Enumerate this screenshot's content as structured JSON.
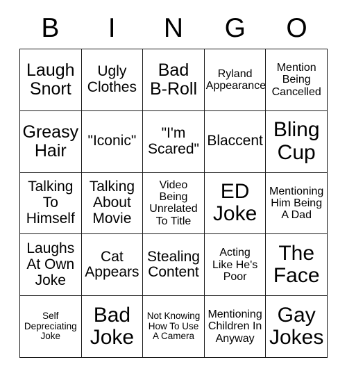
{
  "card": {
    "header_letters": [
      "B",
      "I",
      "N",
      "G",
      "O"
    ],
    "border_color": "#1a1a1a",
    "background_color": "#ffffff",
    "text_color": "#000000",
    "rows": 5,
    "columns": 5
  },
  "cells": [
    {
      "text": "Laugh\nSnort",
      "size": "s-lg"
    },
    {
      "text": "Ugly\nClothes",
      "size": "s-md"
    },
    {
      "text": "Bad\nB-Roll",
      "size": "s-lg"
    },
    {
      "text": "Ryland\nAppearance",
      "size": "s-sm"
    },
    {
      "text": "Mention\nBeing\nCancelled",
      "size": "s-sm"
    },
    {
      "text": "Greasy\nHair",
      "size": "s-lg"
    },
    {
      "text": "\"Iconic\"",
      "size": "s-md"
    },
    {
      "text": "\"I'm\nScared\"",
      "size": "s-md"
    },
    {
      "text": "Blaccent",
      "size": "s-md"
    },
    {
      "text": "Bling\nCup",
      "size": "s-xl"
    },
    {
      "text": "Talking\nTo\nHimself",
      "size": "s-md"
    },
    {
      "text": "Talking\nAbout\nMovie",
      "size": "s-md"
    },
    {
      "text": "Video\nBeing\nUnrelated\nTo Title",
      "size": "s-sm"
    },
    {
      "text": "ED\nJoke",
      "size": "s-xl"
    },
    {
      "text": "Mentioning\nHim Being\nA Dad",
      "size": "s-sm"
    },
    {
      "text": "Laughs\nAt Own\nJoke",
      "size": "s-md"
    },
    {
      "text": "Cat\nAppears",
      "size": "s-md"
    },
    {
      "text": "Stealing\nContent",
      "size": "s-md"
    },
    {
      "text": "Acting\nLike He's\nPoor",
      "size": "s-sm"
    },
    {
      "text": "The\nFace",
      "size": "s-xl"
    },
    {
      "text": "Self\nDepreciating\nJoke",
      "size": "s-xs"
    },
    {
      "text": "Bad\nJoke",
      "size": "s-xl"
    },
    {
      "text": "Not Knowing\nHow To Use\nA Camera",
      "size": "s-xs"
    },
    {
      "text": "Mentioning\nChildren In\nAnyway",
      "size": "s-sm"
    },
    {
      "text": "Gay\nJokes",
      "size": "s-xl"
    }
  ]
}
